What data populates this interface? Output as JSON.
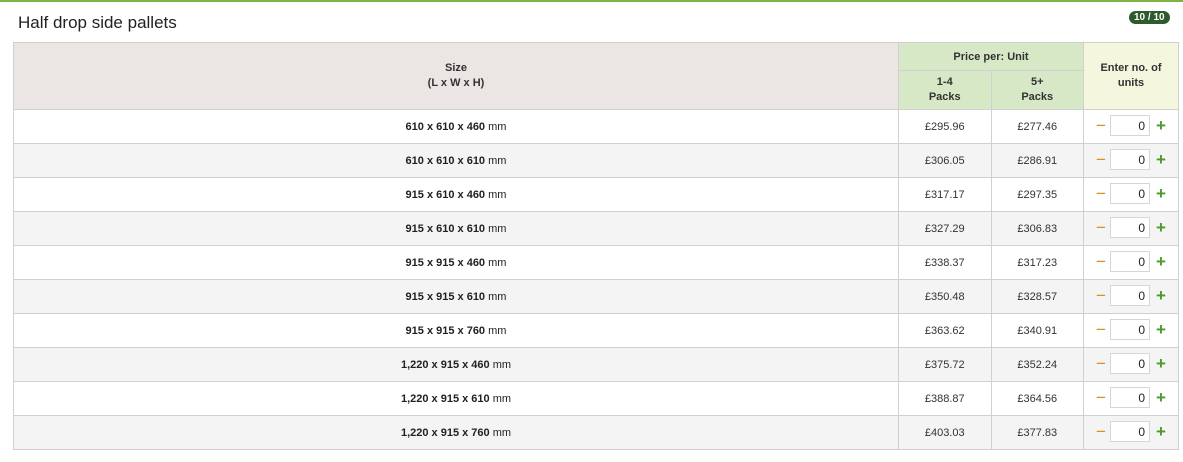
{
  "section": {
    "title": "Half drop side pallets",
    "counter": "10 / 10"
  },
  "table": {
    "size_header": "Size",
    "size_subheader": "(L x W x H)",
    "price_header": "Price per:  Unit",
    "pack_headers": [
      {
        "line1": "1-4",
        "line2": "Packs"
      },
      {
        "line1": "5+",
        "line2": "Packs"
      }
    ],
    "qty_header_line1": "Enter no. of",
    "qty_header_line2": "units",
    "unit_suffix": "mm",
    "rows": [
      {
        "size": "610 x 610 x 460",
        "price1": "£295.96",
        "price2": "£277.46",
        "qty": "0"
      },
      {
        "size": "610 x 610 x 610",
        "price1": "£306.05",
        "price2": "£286.91",
        "qty": "0"
      },
      {
        "size": "915 x 610 x 460",
        "price1": "£317.17",
        "price2": "£297.35",
        "qty": "0"
      },
      {
        "size": "915 x 610 x 610",
        "price1": "£327.29",
        "price2": "£306.83",
        "qty": "0"
      },
      {
        "size": "915 x 915 x 460",
        "price1": "£338.37",
        "price2": "£317.23",
        "qty": "0"
      },
      {
        "size": "915 x 915 x 610",
        "price1": "£350.48",
        "price2": "£328.57",
        "qty": "0"
      },
      {
        "size": "915 x 915 x 760",
        "price1": "£363.62",
        "price2": "£340.91",
        "qty": "0"
      },
      {
        "size": "1,220 x 915 x 460",
        "price1": "£375.72",
        "price2": "£352.24",
        "qty": "0"
      },
      {
        "size": "1,220 x 915 x 610",
        "price1": "£388.87",
        "price2": "£364.56",
        "qty": "0"
      },
      {
        "size": "1,220 x 915 x 760",
        "price1": "£403.03",
        "price2": "£377.83",
        "qty": "0"
      }
    ]
  },
  "stepper": {
    "minus_icon": "minus-icon",
    "plus_icon": "plus-icon",
    "minus_glyph": "−",
    "plus_glyph": "+"
  },
  "colors": {
    "accent": "#7cb342",
    "price_header_bg": "#d6e8c6",
    "qty_header_bg": "#f4f7de",
    "size_header_bg": "#ebe5e3"
  }
}
